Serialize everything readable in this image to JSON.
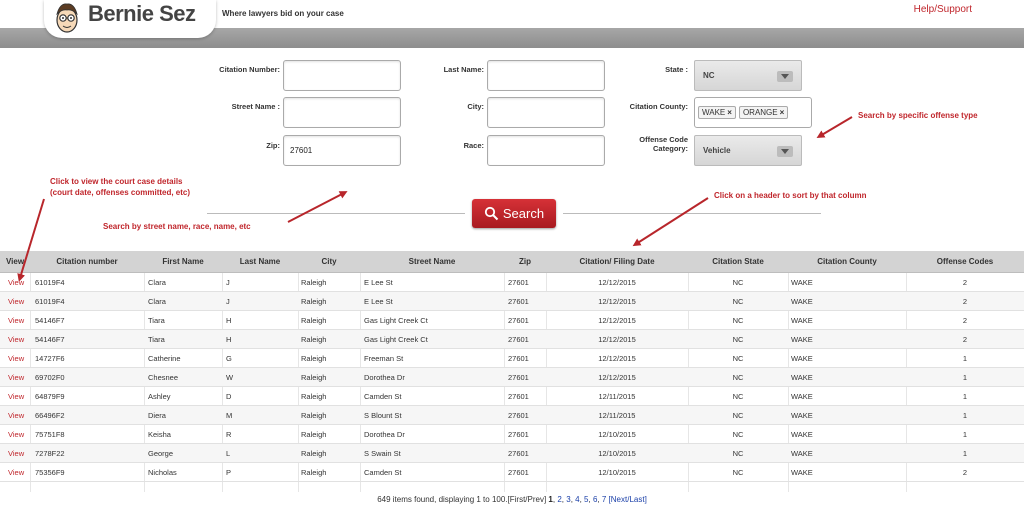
{
  "header": {
    "brand": "Bernie Sez",
    "tagline": "Where lawyers bid on your case",
    "help_link": "Help/Support"
  },
  "form": {
    "citation_number": {
      "label": "Citation Number:",
      "value": ""
    },
    "last_name": {
      "label": "Last Name:",
      "value": ""
    },
    "state": {
      "label": "State :",
      "value": "NC"
    },
    "street_name": {
      "label": "Street Name :",
      "value": ""
    },
    "city": {
      "label": "City:",
      "value": ""
    },
    "citation_county": {
      "label": "Citation County:",
      "tags": [
        "WAKE",
        "ORANGE"
      ]
    },
    "zip": {
      "label": "Zip:",
      "value": "27601"
    },
    "race": {
      "label": "Race:",
      "value": ""
    },
    "offense_code_category": {
      "label_line1": "Offense Code",
      "label_line2": "Category:",
      "value": "Vehicle"
    },
    "search_button": "Search"
  },
  "annotations": {
    "offense_type": "Search by specific offense type",
    "view_details_1": "Click to view the court case details",
    "view_details_2": "(court date, offenses committed, etc)",
    "sort_header": "Click on a header to sort by that column",
    "street_search": "Search by street name, race, name, etc"
  },
  "table": {
    "columns": [
      "View",
      "Citation number",
      "First Name",
      "Last Name",
      "City",
      "Street Name",
      "Zip",
      "Citation/ Filing Date",
      "Citation State",
      "Citation County",
      "Offense Codes"
    ],
    "rows": [
      [
        "View",
        "61019F4",
        "Clara",
        "J",
        "Raleigh",
        "E Lee St",
        "27601",
        "12/12/2015",
        "NC",
        "WAKE",
        "2"
      ],
      [
        "View",
        "61019F4",
        "Clara",
        "J",
        "Raleigh",
        "E Lee St",
        "27601",
        "12/12/2015",
        "NC",
        "WAKE",
        "2"
      ],
      [
        "View",
        "54146F7",
        "Tiara",
        "H",
        "Raleigh",
        "Gas Light Creek Ct",
        "27601",
        "12/12/2015",
        "NC",
        "WAKE",
        "2"
      ],
      [
        "View",
        "54146F7",
        "Tiara",
        "H",
        "Raleigh",
        "Gas Light Creek Ct",
        "27601",
        "12/12/2015",
        "NC",
        "WAKE",
        "2"
      ],
      [
        "View",
        "14727F6",
        "Catherine",
        "G",
        "Raleigh",
        "Freeman St",
        "27601",
        "12/12/2015",
        "NC",
        "WAKE",
        "1"
      ],
      [
        "View",
        "69702F0",
        "Chesnee",
        "W",
        "Raleigh",
        "Dorothea Dr",
        "27601",
        "12/12/2015",
        "NC",
        "WAKE",
        "1"
      ],
      [
        "View",
        "64879F9",
        "Ashley",
        "D",
        "Raleigh",
        "Camden St",
        "27601",
        "12/11/2015",
        "NC",
        "WAKE",
        "1"
      ],
      [
        "View",
        "66496F2",
        "Diera",
        "M",
        "Raleigh",
        "S Blount St",
        "27601",
        "12/11/2015",
        "NC",
        "WAKE",
        "1"
      ],
      [
        "View",
        "75751F8",
        "Keisha",
        "R",
        "Raleigh",
        "Dorothea Dr",
        "27601",
        "12/10/2015",
        "NC",
        "WAKE",
        "1"
      ],
      [
        "View",
        "7278F22",
        "George",
        "L",
        "Raleigh",
        "S Swain St",
        "27601",
        "12/10/2015",
        "NC",
        "WAKE",
        "1"
      ],
      [
        "View",
        "75356F9",
        "Nicholas",
        "P",
        "Raleigh",
        "Camden St",
        "27601",
        "12/10/2015",
        "NC",
        "WAKE",
        "2"
      ]
    ]
  },
  "pagination": {
    "summary": "649 items found, displaying 1 to 100.",
    "first_prev": "[First/Prev]",
    "current": "1",
    "pages": [
      "2",
      "3",
      "4",
      "5",
      "6",
      "7"
    ],
    "next_last": "[Next/Last]"
  },
  "colors": {
    "accent": "#c0262c",
    "link": "#1a3fa8",
    "header_band": "#9a9a9a"
  }
}
